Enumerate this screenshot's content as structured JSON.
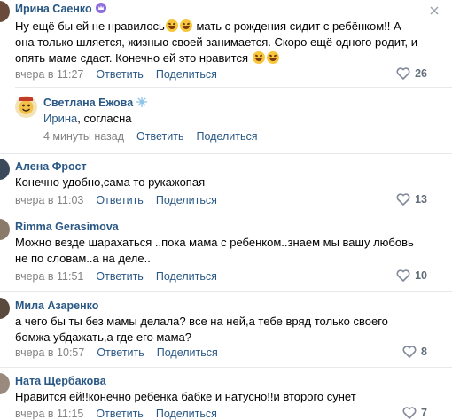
{
  "comments": [
    {
      "author": "Ирина Саенко",
      "text_parts": [
        "Ну ещё бы ей не нравилось",
        " мать с рождения сидит с ребёнком!! А\nона только шляется, жизнью своей занимается. Скоро ещё одного родит, и\nопять маме сдаст. Конечно ей это нравится "
      ],
      "time": "вчера в 11:27",
      "reply": "Ответить",
      "share": "Поделиться",
      "likes": "26"
    },
    {
      "author": "Светлана Ежова",
      "reply_to": "Ирина",
      "text": ", согласна",
      "time": "4 минуты назад",
      "reply": "Ответить",
      "share": "Поделиться"
    },
    {
      "author": "Алена Фрост",
      "text": "Конечно удобно,сама то рукажопая",
      "time": "вчера в 11:03",
      "reply": "Ответить",
      "share": "Поделиться",
      "likes": "13"
    },
    {
      "author": "Rimma Gerasimova",
      "text": "Можно везде шарахаться ..пока мама с ребенком..знаем мы вашу любовь\nне по словам..а на деле..",
      "time": "вчера в 11:51",
      "reply": "Ответить",
      "share": "Поделиться",
      "likes": "10"
    },
    {
      "author": "Мила Азаренко",
      "text": "а чего бы ты без мамы делала? все на ней,а тебе вряд только своего\nбомжа убдажать,а где его мама?",
      "time": "вчера в 10:57",
      "reply": "Ответить",
      "share": "Поделиться",
      "likes": "8"
    },
    {
      "author": "Ната Щербакова",
      "text": "Нравится ей!!конечно ребенка бабке и натусно!!и второго сунет",
      "time": "вчера в 11:15",
      "reply": "Ответить",
      "share": "Поделиться",
      "likes": "7"
    }
  ],
  "icons": {
    "like": "heart-outline-icon",
    "close": "close-icon",
    "badge": "crown-badge-icon",
    "snowflake": "snowflake-icon"
  },
  "colors": {
    "link": "#2a5885",
    "meta": "#828282",
    "like": "#626d7a",
    "separator": "#e7e8ec"
  }
}
